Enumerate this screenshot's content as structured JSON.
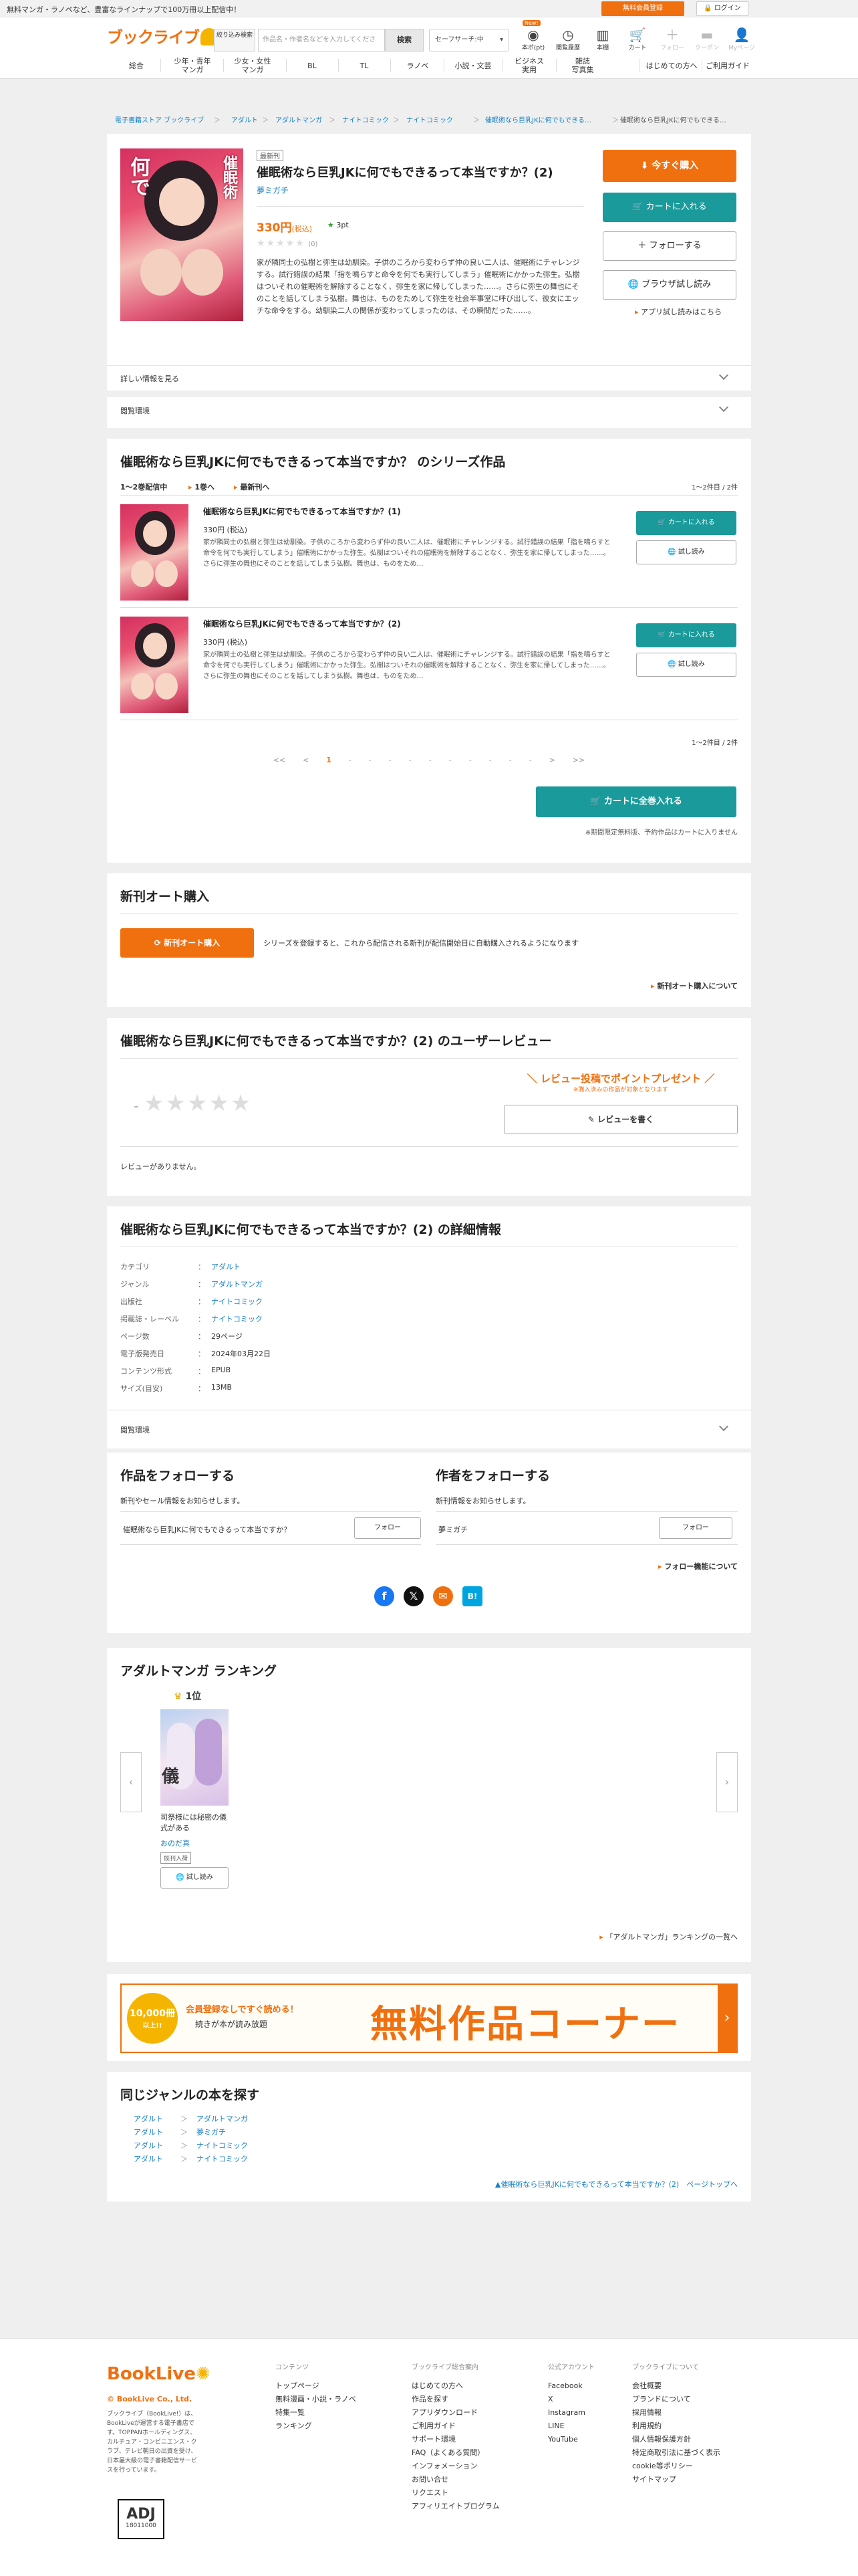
{
  "topbar": {
    "message": "無料マンガ・ラノベなど、豊富なラインナップで100万冊以上配信中！",
    "register": "無料会員登録",
    "login": "ログイン"
  },
  "header": {
    "logo": "ブックライブ",
    "narrow": "絞り込み検索",
    "search_placeholder": "作品名・作者名などを入力してください",
    "search_button": "検索",
    "safe_search": "セーフサーチ:中",
    "icons": [
      {
        "label": "本ポ(pt)",
        "icon": "coin-icon",
        "badge": "New!"
      },
      {
        "label": "閲覧履歴",
        "icon": "clock-icon"
      },
      {
        "label": "本棚",
        "icon": "bookshelf-icon"
      },
      {
        "label": "カート",
        "icon": "cart-icon"
      },
      {
        "label": "フォロー",
        "icon": "plus-icon"
      },
      {
        "label": "クーポン",
        "icon": "coupon-icon"
      },
      {
        "label": "Myページ",
        "icon": "person-icon"
      }
    ]
  },
  "gnav": [
    "総合",
    "少年・青年\nマンガ",
    "少女・女性\nマンガ",
    "BL",
    "TL",
    "ラノベ",
    "小説・文芸",
    "ビジネス\n実用",
    "雑誌\n写真集"
  ],
  "gnav_right": [
    "はじめての方へ",
    "ご利用ガイド"
  ],
  "breadcrumbs": [
    "電子書籍ストア ブックライブ",
    "アダルト",
    "アダルトマンガ",
    "ナイトコミック",
    "ナイトコミック",
    "催眠術なら巨乳JKに何でもできる…",
    "催眠術なら巨乳JKに何でもできる…"
  ],
  "product": {
    "badge": "最新刊",
    "title": "催眠術なら巨乳JKに何でもできるって本当ですか？(2)",
    "author": "夢ミガチ",
    "price": "330円",
    "tax": "(税込)",
    "points": "3pt",
    "rating_count": "(0)",
    "description": "家が隣同士の弘樹と弥生は幼馴染。子供のころから変わらず仲の良い二人は、催眠術にチャレンジする。試行錯誤の結果「指を鳴らすと命令を何でも実行してしまう」催眠術にかかった弥生。弘樹はついそれの催眠術を解除することなく、弥生を家に帰してしまった……。さらに弥生の舞也にそのことを話してしまう弘樹。舞也は、ものをためして弥生を社会半事堂に呼び出して、彼女にエッチな命令をする。幼馴染二人の関係が変わってしまったのは、その瞬間だった……。",
    "buy_now": "今すぐ購入",
    "add_cart": "カートに入れる",
    "follow": "フォローする",
    "browser_read": "ブラウザ試し読み",
    "app_read": "アプリ試し読みはこちら",
    "details_toggle": "詳しい情報を見る",
    "env_toggle": "閲覧環境"
  },
  "series": {
    "heading": "催眠術なら巨乳JKに何でもできるって本当ですか？ のシリーズ作品",
    "status": "1〜2巻配信中",
    "to_first": "1巻へ",
    "to_latest": "最新刊へ",
    "count": "1〜2件目 / 2件",
    "items": [
      {
        "title": "催眠術なら巨乳JKに何でもできるって本当ですか？(1)",
        "price": "330円 (税込)",
        "desc": "家が隣同士の弘樹と弥生は幼馴染。子供のころから変わらず仲の良い二人は、催眠術にチャレンジする。試行錯誤の結果「指を鳴らすと命令を何でも実行してしまう」催眠術にかかった弥生。弘樹はついそれの催眠術を解除することなく、弥生を家に帰してしまった……。さらに弥生の舞也にそのことを話してしまう弘樹。舞也は、ものをため…",
        "cart": "カートに入れる",
        "trial": "試し読み"
      },
      {
        "title": "催眠術なら巨乳JKに何でもできるって本当ですか？(2)",
        "price": "330円 (税込)",
        "desc": "家が隣同士の弘樹と弥生は幼馴染。子供のころから変わらず仲の良い二人は、催眠術にチャレンジする。試行錯誤の結果「指を鳴らすと命令を何でも実行してしまう」催眠術にかかった弥生。弘樹はついそれの催眠術を解除することなく、弥生を家に帰してしまった……。さらに弥生の舞也にそのことを話してしまう弘樹。舞也は、ものをため…",
        "cart": "カートに入れる",
        "trial": "試し読み"
      }
    ],
    "count_bottom": "1〜2件目 / 2件",
    "pager": [
      "<<",
      "<",
      "1",
      "-",
      "-",
      "-",
      "-",
      "-",
      "-",
      "-",
      "-",
      "-",
      "-",
      ">",
      ">>"
    ],
    "cart_all": "カートに全巻入れる",
    "note": "※期間限定無料版、予約作品はカートに入りません"
  },
  "auto_buy": {
    "heading": "新刊オート購入",
    "button": "新刊オート購入",
    "text": "シリーズを登録すると、これから配信される新刊が配信開始日に自動購入されるようになります",
    "link": "新刊オート購入について"
  },
  "reviews": {
    "heading": "催眠術なら巨乳JKに何でもできるって本当ですか？(2) のユーザーレビュー",
    "score": "-",
    "promo": "＼ レビュー投稿でポイントプレゼント ／",
    "promo_note": "※購入済みの作品が対象となります",
    "write": "レビューを書く",
    "empty": "レビューがありません。"
  },
  "details": {
    "heading": "催眠術なら巨乳JKに何でもできるって本当ですか？(2) の詳細情報",
    "rows": [
      {
        "k": "カテゴリ",
        "v": "アダルト",
        "link": true
      },
      {
        "k": "ジャンル",
        "v": "アダルトマンガ",
        "link": true
      },
      {
        "k": "出版社",
        "v": "ナイトコミック",
        "link": true
      },
      {
        "k": "掲載誌・レーベル",
        "v": "ナイトコミック",
        "link": true
      },
      {
        "k": "ページ数",
        "v": "29ページ",
        "link": false
      },
      {
        "k": "電子版発売日",
        "v": "2024年03月22日",
        "link": false
      },
      {
        "k": "コンテンツ形式",
        "v": "EPUB",
        "link": false
      },
      {
        "k": "サイズ(目安)",
        "v": "13MB",
        "link": false
      }
    ],
    "env": "閲覧環境"
  },
  "follow": {
    "work_heading": "作品をフォローする",
    "work_text": "新刊やセール情報をお知らせします。",
    "work_item": "催眠術なら巨乳JKに何でもできるって本当ですか？",
    "author_heading": "作者をフォローする",
    "author_text": "新刊情報をお知らせします。",
    "author_item": "夢ミガチ",
    "follow_btn": "フォロー",
    "about": "フォロー機能について",
    "share": [
      "facebook-icon",
      "x-icon",
      "mail-icon",
      "hatena-icon"
    ]
  },
  "ranking": {
    "heading": "アダルトマンガ ランキング",
    "rank": "1位",
    "title": "司祭様には秘密の儀式がある",
    "author": "おのだ真",
    "tag": "既刊入荷",
    "trial": "試し読み",
    "more": "「アダルトマンガ」ランキングの一覧へ"
  },
  "banner": {
    "count": "10,000冊",
    "count_sub": "以上!!",
    "line1": "会員登録なしですぐ読める！",
    "line2": "続きが本が読み放題",
    "big": "無料作品コーナー"
  },
  "same_genre": {
    "heading": "同じジャンルの本を探す",
    "rows": [
      [
        "アダルト",
        "アダルトマンガ"
      ],
      [
        "アダルト",
        "夢ミガチ"
      ],
      [
        "アダルト",
        "ナイトコミック"
      ],
      [
        "アダルト",
        "ナイトコミック"
      ]
    ],
    "top_link": "催眠術なら巨乳JKに何でもできるって本当ですか？(2)　ページトップへ"
  },
  "footer": {
    "logo": "BookLive",
    "company": "© BookLive Co., Ltd.",
    "about": "ブックライブ（BookLive!）は、BookLiveが運営する電子書店です。TOPPANホールディングス、カルチュア・コンビニエンス・クラブ、テレビ朝日の出資を受け、日本最大級の電子書籍配信サービスを行っています。",
    "adj": "ADJ",
    "adj_num": "18011000",
    "cols": [
      {
        "title": "コンテンツ",
        "items": [
          "トップページ",
          "無料漫画・小説・ラノベ",
          "特集一覧",
          "ランキング"
        ]
      },
      {
        "title": "ブックライブ総合案内",
        "items": [
          "はじめての方へ",
          "作品を探す",
          "アプリダウンロード",
          "ご利用ガイド",
          "サポート環境",
          "FAQ（よくある質問）",
          "インフォメーション",
          "お問い合せ",
          "リクエスト",
          "アフィリエイトプログラム"
        ]
      },
      {
        "title": "公式アカウント",
        "items": [
          "Facebook",
          "X",
          "Instagram",
          "LINE",
          "YouTube"
        ]
      },
      {
        "title": "ブックライブについて",
        "items": [
          "会社概要",
          "プランドについて",
          "採用情報",
          "利用規約",
          "個人情報保護方針",
          "特定商取引法に基づく表示",
          "cookie等ポリシー",
          "サイトマップ"
        ]
      }
    ]
  },
  "colors": {
    "orange": "#f07010",
    "teal": "#1a9a9a",
    "link": "#157fc6"
  }
}
